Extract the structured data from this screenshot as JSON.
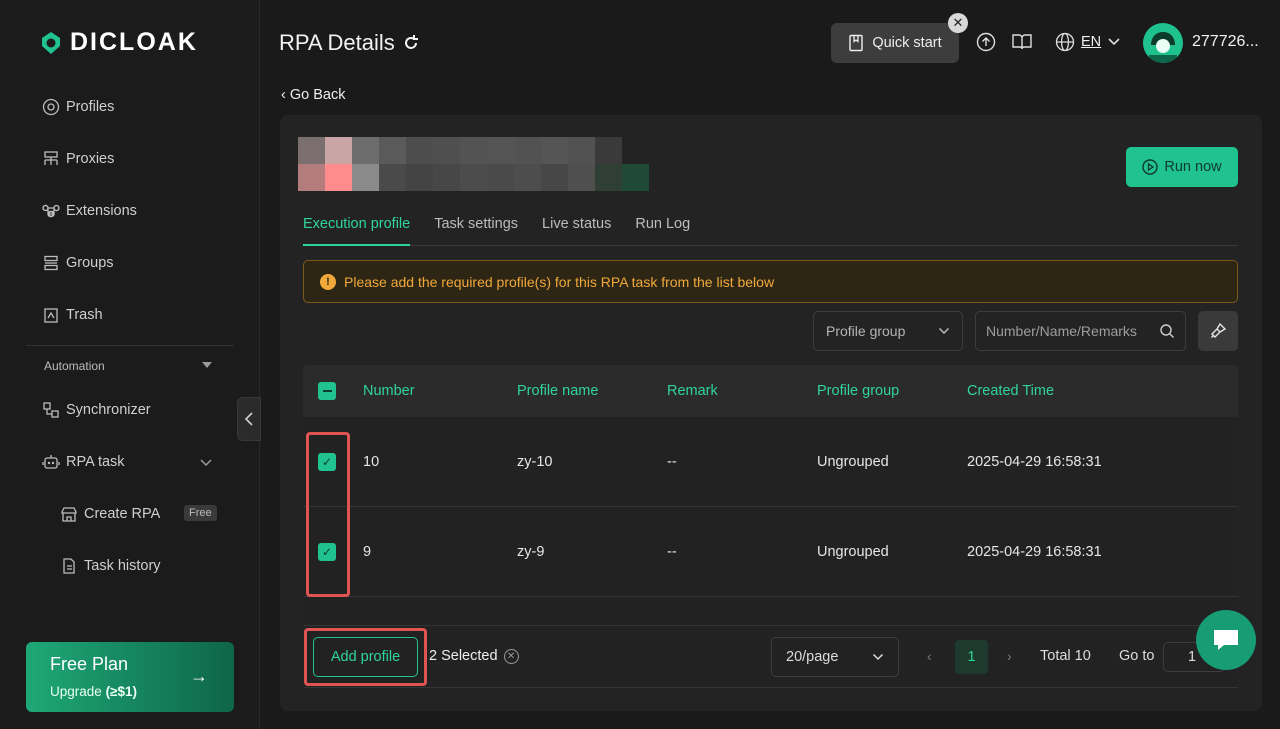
{
  "brand": {
    "name": "DICLOAK",
    "accent": "#20c290"
  },
  "sidebar": {
    "items": [
      {
        "label": "Profiles",
        "icon": "chrome-icon"
      },
      {
        "label": "Proxies",
        "icon": "network-icon"
      },
      {
        "label": "Extensions",
        "icon": "command-icon"
      },
      {
        "label": "Groups",
        "icon": "layers-icon"
      },
      {
        "label": "Trash",
        "icon": "trash-icon"
      }
    ],
    "section_label": "Automation",
    "automation_items": [
      {
        "label": "Synchronizer",
        "icon": "sync-icon"
      },
      {
        "label": "RPA task",
        "icon": "robot-icon"
      }
    ],
    "sub_items": [
      {
        "label": "Create RPA",
        "icon": "store-icon",
        "badge": "Free"
      },
      {
        "label": "Task history",
        "icon": "document-icon"
      }
    ],
    "plan": {
      "title": "Free Plan",
      "subtitle_prefix": "Upgrade",
      "subtitle_bold": "(≥$1)"
    }
  },
  "header": {
    "title": "RPA Details",
    "quick_start": "Quick start",
    "language": "EN",
    "username": "277726..."
  },
  "go_back": "Go Back",
  "run_now": "Run now",
  "tabs": [
    "Execution profile",
    "Task settings",
    "Live status",
    "Run Log"
  ],
  "alert": "Please add the required profile(s) for this RPA task from the list below",
  "filters": {
    "profile_group": "Profile group",
    "search_placeholder": "Number/Name/Remarks"
  },
  "table": {
    "headers": [
      "Number",
      "Profile name",
      "Remark",
      "Profile group",
      "Created Time"
    ],
    "rows": [
      {
        "number": "10",
        "name": "zy-10",
        "remark": "--",
        "group": "Ungrouped",
        "created": "2025-04-29 16:58:31"
      },
      {
        "number": "9",
        "name": "zy-9",
        "remark": "--",
        "group": "Ungrouped",
        "created": "2025-04-29 16:58:31"
      }
    ]
  },
  "footer": {
    "add_profile": "Add profile",
    "selected": "2 Selected",
    "per_page": "20/page",
    "current_page": "1",
    "total": "Total 10",
    "goto_label": "Go to",
    "goto_value": "1"
  }
}
